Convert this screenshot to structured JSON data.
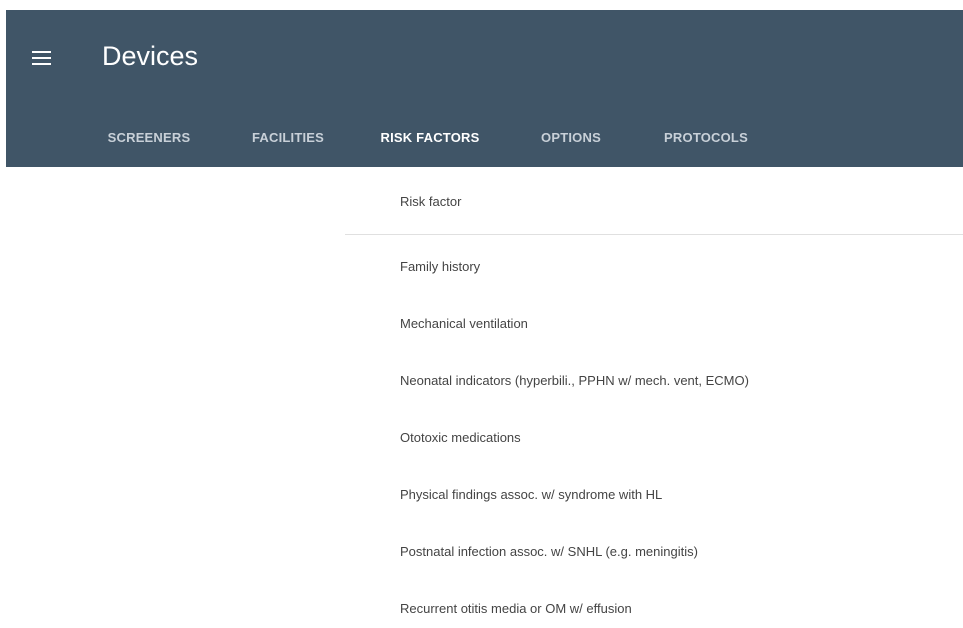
{
  "header": {
    "title": "Devices",
    "menu_icon": "menu-icon",
    "background": "#405567"
  },
  "tabs": [
    {
      "label": "SCREENERS",
      "active": false
    },
    {
      "label": "FACILITIES",
      "active": false
    },
    {
      "label": "RISK FACTORS",
      "active": true
    },
    {
      "label": "OPTIONS",
      "active": false
    },
    {
      "label": "PROTOCOLS",
      "active": false
    }
  ],
  "risk_factors": {
    "column_header": "Risk factor",
    "items": [
      "Family history",
      "Mechanical ventilation",
      "Neonatal indicators (hyperbili., PPHN w/ mech. vent, ECMO)",
      "Ototoxic medications",
      "Physical findings assoc. w/ syndrome with HL",
      "Postnatal infection assoc. w/ SNHL (e.g. meningitis)",
      "Recurrent otitis media or OM w/ effusion"
    ]
  }
}
